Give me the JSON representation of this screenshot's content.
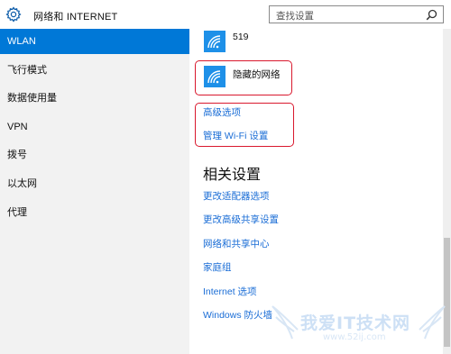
{
  "header": {
    "title": "网络和 INTERNET",
    "search_placeholder": "查找设置",
    "icons": {
      "settings": "gear-icon",
      "search": "search-icon"
    }
  },
  "sidebar": {
    "items": [
      {
        "label": "WLAN",
        "active": true
      },
      {
        "label": "飞行模式",
        "active": false
      },
      {
        "label": "数据使用量",
        "active": false
      },
      {
        "label": "VPN",
        "active": false
      },
      {
        "label": "拨号",
        "active": false
      },
      {
        "label": "以太网",
        "active": false
      },
      {
        "label": "代理",
        "active": false
      }
    ]
  },
  "main": {
    "networks": [
      {
        "name": "519",
        "icon": "wifi-icon"
      },
      {
        "name": "隐藏的网络",
        "icon": "wifi-icon"
      }
    ],
    "links": {
      "advanced": "高级选项",
      "manage_wifi": "管理 Wi-Fi 设置"
    },
    "related": {
      "title": "相关设置",
      "items": [
        "更改适配器选项",
        "更改高级共享设置",
        "网络和共享中心",
        "家庭组",
        "Internet 选项",
        "Windows 防火墙"
      ]
    }
  },
  "watermark": {
    "text": "我爱IT技术网",
    "url": "www.52ij.com"
  },
  "colors": {
    "accent": "#0078d7",
    "link": "#1a6dd6",
    "highlight_box": "#d9182d",
    "sidebar_bg": "#f2f2f2"
  }
}
